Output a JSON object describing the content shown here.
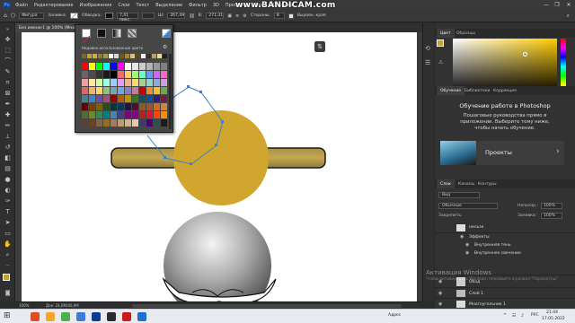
{
  "app": {
    "logo": "Ps",
    "menu": [
      "Файл",
      "Редактирование",
      "Изображение",
      "Слои",
      "Текст",
      "Выделение",
      "Фильтр",
      "3D",
      "Просмотр",
      "Окно",
      "Справка"
    ],
    "window_controls": [
      "—",
      "❐",
      "✕"
    ]
  },
  "overlay": {
    "watermark": "www.BANDICAM.com"
  },
  "options_bar": {
    "tool_mode": "Фигура",
    "fill_label": "Заливка:",
    "stroke_label": "Обводка:",
    "stroke_width": "7,41 пикс.",
    "width_label": "Ш:",
    "width_value": "267,49",
    "height_label": "В:",
    "height_value": "271,31",
    "corners_label": "Стороны:",
    "corners_value": "8",
    "align_edges": "Выровн. края"
  },
  "document": {
    "tab_title": "Без имени-1 @ 100% (Мно",
    "zoom": "100%",
    "doc_info": "Док: 24,6М/40,9М"
  },
  "swatch_popup": {
    "recent_label": "Недавно использованные цвета",
    "recent_colors": [
      "#7a6a2a",
      "#c9a227",
      "#d4af37",
      "#8a7a3a",
      "#b49432",
      "#ffffff",
      "#d9d9d9",
      "#6b5a1f",
      "#a88a2a",
      "#e0c060",
      "#5a4a1a",
      "#f2f2f2",
      "#333333",
      "#c0a050",
      "#e8d8a0",
      "#1f1f1f"
    ],
    "grid_colors": [
      [
        "#ff0000",
        "#ffff00",
        "#00ff00",
        "#00ffff",
        "#0000ff",
        "#ff00ff",
        "#ffffff",
        "#e6e6e6",
        "#cccccc",
        "#b3b3b3",
        "#999999",
        "#808080"
      ],
      [
        "#666666",
        "#4d4d4d",
        "#333333",
        "#1a1a1a",
        "#000000",
        "#ff6666",
        "#ffcc66",
        "#99ff66",
        "#66ffcc",
        "#6699ff",
        "#cc66ff",
        "#ff66cc"
      ],
      [
        "#ff9999",
        "#ffe699",
        "#ccff99",
        "#99ffe6",
        "#99ccff",
        "#e699ff",
        "#f4b183",
        "#ffd966",
        "#a9d18e",
        "#8fd3c9",
        "#8ea9db",
        "#c9a0dc"
      ],
      [
        "#e06666",
        "#f6b26b",
        "#ffd966",
        "#93c47d",
        "#76a5af",
        "#6fa8dc",
        "#8e7cc3",
        "#c27ba0",
        "#cc0000",
        "#e69138",
        "#f1c232",
        "#6aa84f"
      ],
      [
        "#45818e",
        "#3d85c6",
        "#674ea7",
        "#a64d79",
        "#990000",
        "#b45f06",
        "#bf9000",
        "#38761d",
        "#134f5c",
        "#0b5394",
        "#351c75",
        "#741b47"
      ],
      [
        "#660000",
        "#783f04",
        "#7f6000",
        "#274e13",
        "#0c343d",
        "#073763",
        "#20124d",
        "#4c1130",
        "#8b5a2b",
        "#a0522d",
        "#d2691e",
        "#cd853f"
      ],
      [
        "#556b2f",
        "#6b8e23",
        "#2e8b57",
        "#008080",
        "#4682b4",
        "#483d8b",
        "#800080",
        "#8b008b",
        "#b22222",
        "#dc143c",
        "#ff4500",
        "#ff8c00"
      ],
      [
        "#5c4033",
        "#704214",
        "#826644",
        "#967117",
        "#a67b5b",
        "#c19a6b",
        "#d2b48c",
        "#e5c8a8",
        "#3b3b6d",
        "#4b0082",
        "#2f4f4f",
        "#1c1c1c"
      ]
    ]
  },
  "color_panel": {
    "tabs": [
      "Цвет",
      "Образцы"
    ],
    "base_hue": "#ffcc00"
  },
  "learn_panel": {
    "tabs": [
      "Обучение",
      "Библиотеки",
      "Коррекция"
    ],
    "title": "Обучение работе в Photoshop",
    "description": "Пошаговые руководства прямо в приложении. Выберите тему ниже, чтобы начать обучение.",
    "card_label": "Проекты",
    "card_arrow": "›"
  },
  "layers_panel": {
    "tabs": [
      "Слои",
      "Каналы",
      "Контуры"
    ],
    "filter_label": "Вид",
    "blend_mode": "Обычные",
    "opacity_label": "Непрозр.:",
    "opacity_value": "100%",
    "lock_label": "Закрепить:",
    "fill_label": "Заливка:",
    "fill_value": "100%",
    "layers": [
      {
        "name": "нельзя",
        "kind": "layer"
      },
      {
        "name": "Эффекты",
        "kind": "effects"
      },
      {
        "name": "Внутренняя тень",
        "kind": "effect"
      },
      {
        "name": "Внутреннее свечение",
        "kind": "effect"
      },
      {
        "name": "Обод",
        "kind": "layer"
      },
      {
        "name": "Слой 1",
        "kind": "layer"
      },
      {
        "name": "Многоугольник 1",
        "kind": "layer"
      }
    ]
  },
  "activation": {
    "title": "Активация Windows",
    "subtitle": "Чтобы активировать Windows, перейдите в раздел \"Параметры\"."
  },
  "taskbar": {
    "tray_address": "Адрес",
    "tray_lang": "РУС",
    "time": "21:44",
    "date": "17.05.2022",
    "app_colors": [
      "#e34c26",
      "#f5a623",
      "#4caf50",
      "#3b7ddd",
      "#0b3d91",
      "#2d2d2d",
      "#c91b1b",
      "#1f6fd1"
    ]
  }
}
